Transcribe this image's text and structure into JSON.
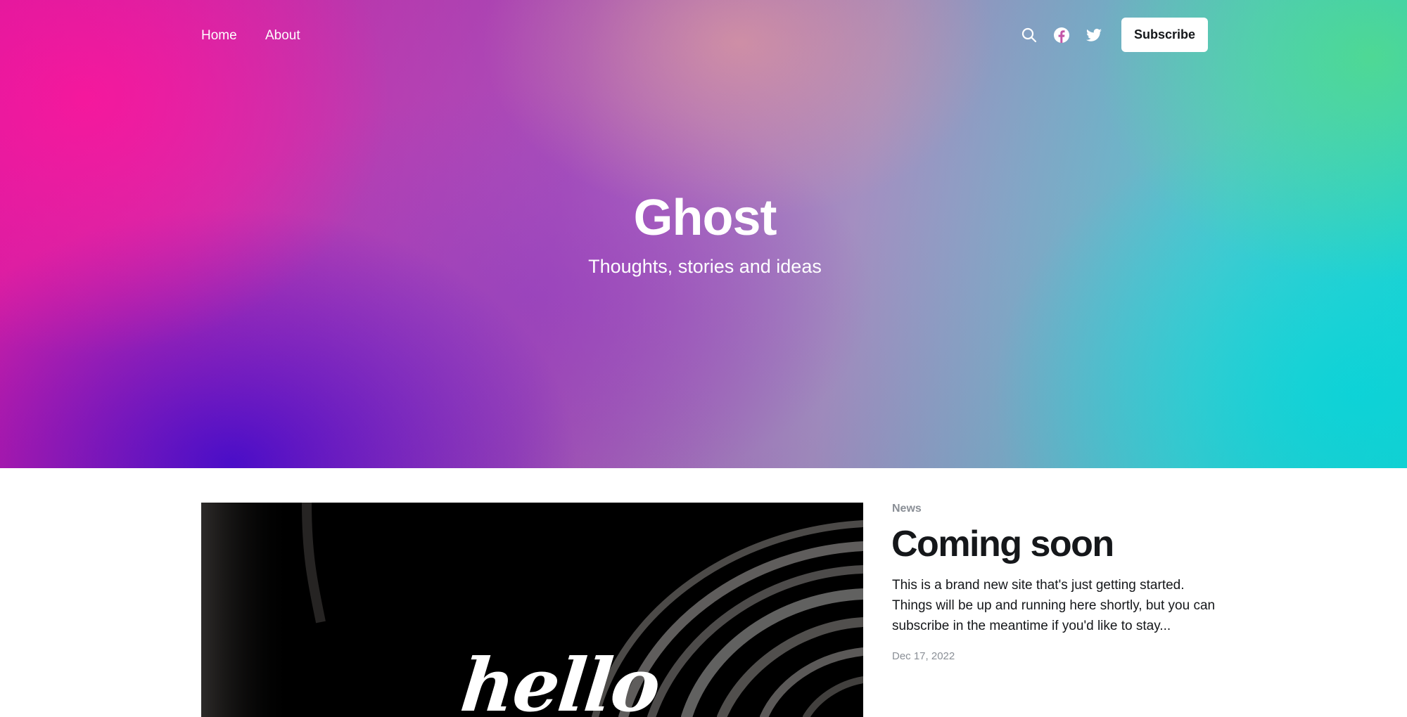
{
  "nav": {
    "links": [
      {
        "label": "Home"
      },
      {
        "label": "About"
      }
    ],
    "icons": [
      "search-icon",
      "facebook-icon",
      "twitter-icon"
    ],
    "subscribe_label": "Subscribe"
  },
  "hero": {
    "title": "Ghost",
    "description": "Thoughts, stories and ideas",
    "gradient_colors": [
      "#ff1aa8",
      "#4a10d2",
      "#a18bc0",
      "#55e39a",
      "#0ad9dc"
    ]
  },
  "featured_post": {
    "image_text": "hello",
    "tag": "News",
    "title": "Coming soon",
    "excerpt": "This is a brand new site that's just getting started. Things will be up and running here shortly, but you can subscribe in the meantime if you'd like to stay...",
    "date": "Dec 17, 2022"
  },
  "colors": {
    "text_primary": "#15171a",
    "text_muted": "#8a8f96",
    "button_bg": "#ffffff"
  }
}
